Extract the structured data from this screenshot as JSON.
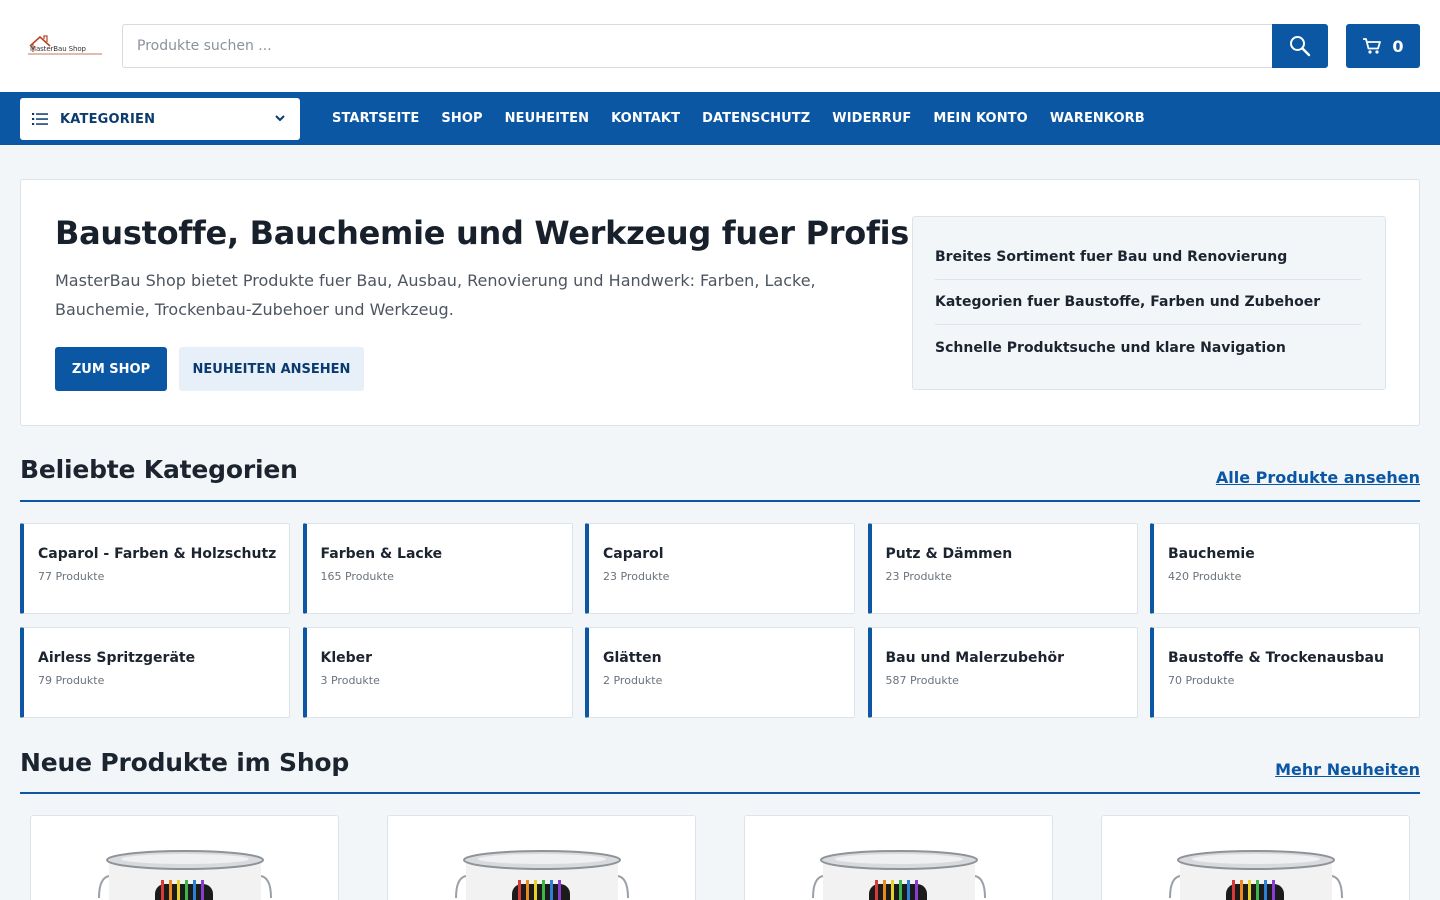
{
  "header": {
    "logo_text": "MasterBau Shop",
    "search_placeholder": "Produkte suchen ...",
    "cart_count": "0",
    "search_icon": "search-icon",
    "cart_icon": "cart-icon"
  },
  "nav": {
    "categories_label": "KATEGORIEN",
    "links": [
      "STARTSEITE",
      "SHOP",
      "NEUHEITEN",
      "KONTAKT",
      "DATENSCHUTZ",
      "WIDERRUF",
      "MEIN KONTO",
      "WARENKORB"
    ]
  },
  "hero": {
    "title": "Baustoffe, Bauchemie und Werkzeug fuer Profis",
    "text": "MasterBau Shop bietet Produkte fuer Bau, Ausbau, Renovierung und Handwerk: Farben, Lacke, Bauchemie, Trockenbau-Zubehoer und Werkzeug.",
    "primary_button": "ZUM SHOP",
    "secondary_button": "NEUHEITEN ANSEHEN",
    "features": [
      "Breites Sortiment fuer Bau und Renovierung",
      "Kategorien fuer Baustoffe, Farben und Zubehoer",
      "Schnelle Produktsuche und klare Navigation"
    ]
  },
  "categories": {
    "title": "Beliebte Kategorien",
    "link": "Alle Produkte ansehen",
    "items": [
      {
        "name": "Caparol - Farben & Holzschutz",
        "count": "77 Produkte"
      },
      {
        "name": "Farben & Lacke",
        "count": "165 Produkte"
      },
      {
        "name": "Caparol",
        "count": "23 Produkte"
      },
      {
        "name": "Putz & Dämmen",
        "count": "23 Produkte"
      },
      {
        "name": "Bauchemie",
        "count": "420 Produkte"
      },
      {
        "name": "Airless Spritzgeräte",
        "count": "79 Produkte"
      },
      {
        "name": "Kleber",
        "count": "3 Produkte"
      },
      {
        "name": "Glätten",
        "count": "2 Produkte"
      },
      {
        "name": "Bau und Malerzubehör",
        "count": "587 Produkte"
      },
      {
        "name": "Baustoffe & Trockenausbau",
        "count": "70 Produkte"
      }
    ]
  },
  "products": {
    "title": "Neue Produkte im Shop",
    "link": "Mehr Neuheiten",
    "image_icon": "paint-bucket-icon"
  },
  "colors": {
    "brand": "#0b57a4",
    "background": "#f3f6f9"
  }
}
